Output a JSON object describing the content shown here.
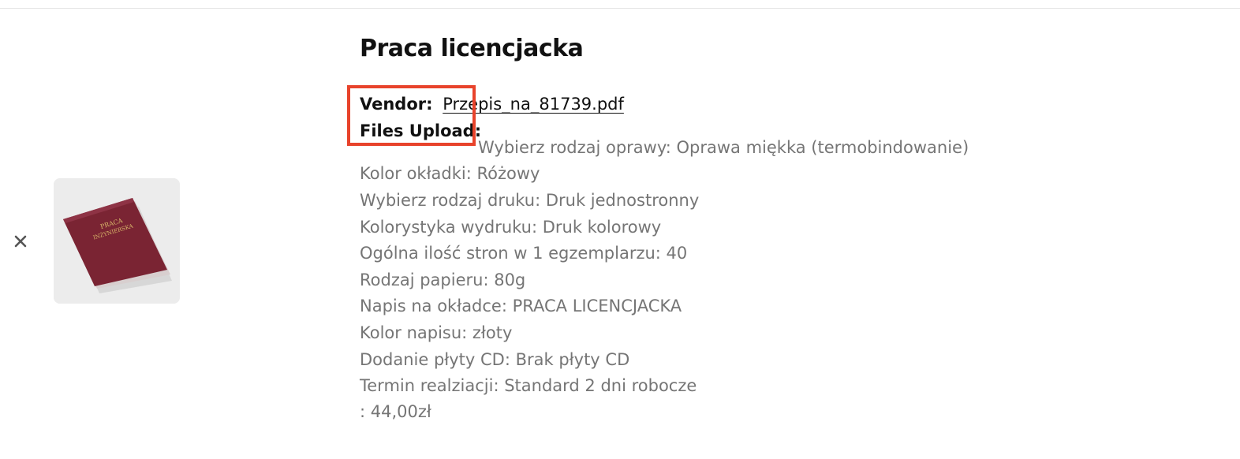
{
  "cart_item": {
    "remove_icon": "close-icon",
    "thumbnail": {
      "cover_text_line1": "PRACA",
      "cover_text_line2": "INŻYNIERSKA",
      "cover_color": "#7a2433"
    },
    "title": "Praca licencjacka",
    "vendor_label": "Vendor:",
    "vendor_value": "Przepis_na_81739.pdf",
    "files_upload_label": "Files Upload:",
    "options": [
      "Wybierz rodzaj oprawy: Oprawa miękka (termobindowanie)",
      "Kolor okładki: Różowy",
      "Wybierz rodzaj druku: Druk jednostronny",
      "Kolorystyka wydruku: Druk kolorowy",
      "Ogólna ilość stron w 1 egzemplarzu: 40",
      "Rodzaj papieru: 80g",
      "Napis na okładce: PRACA LICENCJACKA",
      "Kolor napisu: złoty",
      "Dodanie płyty CD: Brak płyty CD",
      "Termin realziacji: Standard 2 dni robocze"
    ],
    "price": ": 44,00zł"
  },
  "colors": {
    "highlight": "#e8432b",
    "muted_text": "#757575"
  }
}
